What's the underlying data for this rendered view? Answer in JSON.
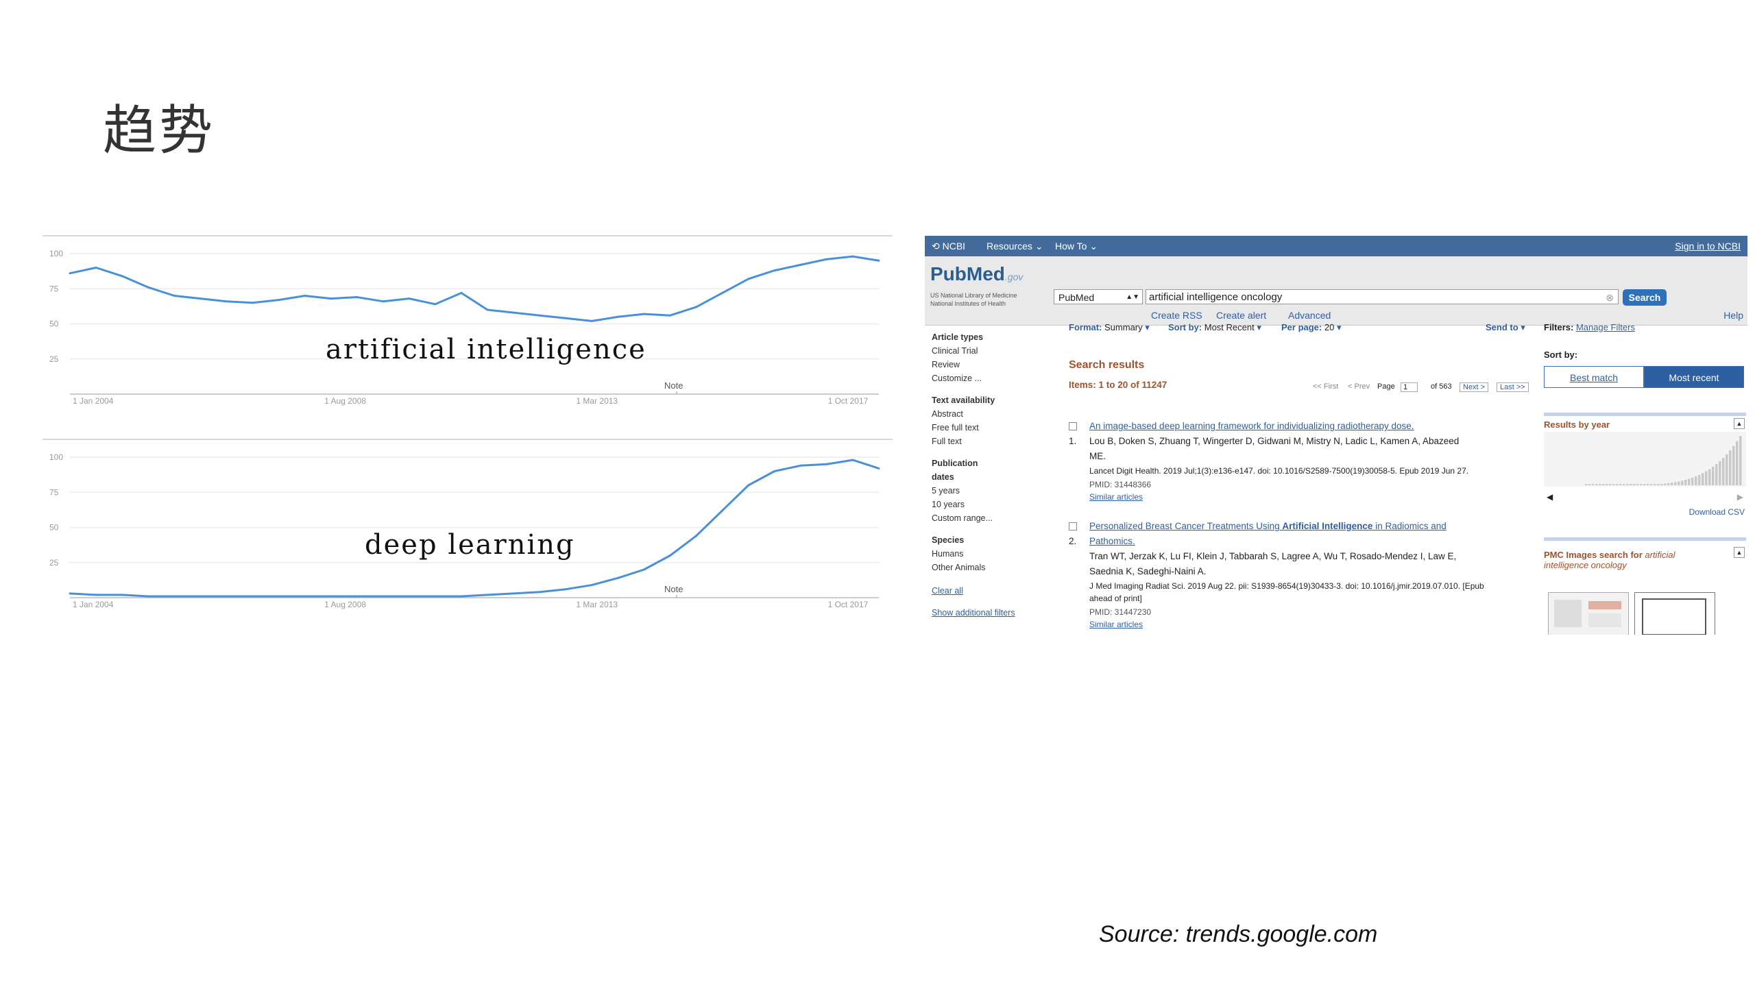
{
  "slide": {
    "title": "趋势",
    "source": "Source: trends.google.com"
  },
  "trends": {
    "ai": {
      "overlay_label": "artificial intelligence",
      "y_ticks": [
        "100",
        "75",
        "50",
        "25"
      ],
      "x_ticks": [
        "1 Jan 2004",
        "1 Aug 2008",
        "1 Mar 2013",
        "1 Oct 2017"
      ],
      "note": "Note",
      "line_color": "#4a90d9"
    },
    "dl": {
      "overlay_label": "deep learning",
      "y_ticks": [
        "100",
        "75",
        "50",
        "25"
      ],
      "x_ticks": [
        "1 Jan 2004",
        "1 Aug 2008",
        "1 Mar 2013",
        "1 Oct 2017"
      ],
      "note": "Note",
      "line_color": "#4a90d9"
    }
  },
  "chart_data": [
    {
      "type": "line",
      "x_ticks": [
        "1 Jan 2004",
        "1 Aug 2008",
        "1 Mar 2013",
        "1 Oct 2017"
      ],
      "ylim": [
        0,
        100
      ],
      "x": [
        2004.0,
        2004.5,
        2005.0,
        2005.5,
        2006.0,
        2006.5,
        2007.0,
        2007.5,
        2008.0,
        2008.5,
        2009.0,
        2009.5,
        2010.0,
        2010.5,
        2011.0,
        2011.5,
        2012.0,
        2012.5,
        2013.0,
        2013.5,
        2014.0,
        2014.5,
        2015.0,
        2015.5,
        2016.0,
        2016.5,
        2017.0,
        2017.5,
        2018.0,
        2018.5,
        2019.0,
        2019.5
      ],
      "values": [
        86,
        90,
        84,
        76,
        70,
        68,
        66,
        65,
        67,
        70,
        68,
        69,
        66,
        68,
        64,
        72,
        60,
        58,
        56,
        54,
        52,
        55,
        57,
        56,
        62,
        72,
        82,
        88,
        92,
        96,
        98,
        95
      ]
    },
    {
      "type": "line",
      "x_ticks": [
        "1 Jan 2004",
        "1 Aug 2008",
        "1 Mar 2013",
        "1 Oct 2017"
      ],
      "ylim": [
        0,
        100
      ],
      "x": [
        2004.0,
        2004.5,
        2005.0,
        2005.5,
        2006.0,
        2006.5,
        2007.0,
        2007.5,
        2008.0,
        2008.5,
        2009.0,
        2009.5,
        2010.0,
        2010.5,
        2011.0,
        2011.5,
        2012.0,
        2012.5,
        2013.0,
        2013.5,
        2014.0,
        2014.5,
        2015.0,
        2015.5,
        2016.0,
        2016.5,
        2017.0,
        2017.5,
        2018.0,
        2018.5,
        2019.0,
        2019.5
      ],
      "values": [
        3,
        2,
        2,
        1,
        1,
        1,
        1,
        1,
        1,
        1,
        1,
        1,
        1,
        1,
        1,
        1,
        2,
        3,
        4,
        6,
        9,
        14,
        20,
        30,
        44,
        62,
        80,
        90,
        94,
        95,
        98,
        92
      ]
    }
  ],
  "pubmed": {
    "top_bar": {
      "ncbi": "NCBI",
      "resources": "Resources",
      "how_to": "How To",
      "sign_in": "Sign in to NCBI"
    },
    "logo": {
      "text": "PubMed",
      "gov": ".gov",
      "sub1": "US National Library of Medicine",
      "sub2": "National Institutes of Health"
    },
    "search": {
      "db": "PubMed",
      "query": "artificial intelligence oncology",
      "button": "Search",
      "create_rss": "Create RSS",
      "create_alert": "Create alert",
      "advanced": "Advanced",
      "help": "Help"
    },
    "filters": {
      "article_types_h": "Article types",
      "clinical_trial": "Clinical Trial",
      "review": "Review",
      "customize": "Customize ...",
      "text_availability_h": "Text availability",
      "abstract": "Abstract",
      "free_full_text": "Free full text",
      "full_text": "Full text",
      "pub_dates_h1": "Publication",
      "pub_dates_h2": "dates",
      "five_years": "5 years",
      "ten_years": "10 years",
      "custom_range": "Custom range...",
      "species_h": "Species",
      "humans": "Humans",
      "other_animals": "Other Animals",
      "clear_all": "Clear all",
      "show_additional": "Show additional filters"
    },
    "toolbar": {
      "format_label": "Format:",
      "format_value": "Summary",
      "sort_label": "Sort by:",
      "sort_value": "Most Recent",
      "perpage_label": "Per page:",
      "perpage_value": "20",
      "send_to": "Send to"
    },
    "results": {
      "heading": "Search results",
      "items": "Items: 1 to 20 of 11247",
      "first": "<< First",
      "prev": "< Prev",
      "page_label": "Page",
      "page_value": "1",
      "of_pages": "of 563",
      "next": "Next >",
      "last": "Last >>",
      "list": [
        {
          "num": "1.",
          "title": "An image-based deep learning framework for individualizing radiotherapy dose.",
          "authors1": "Lou B, Doken S, Zhuang T, Wingerter D, Gidwani M, Mistry N, Ladic L, Kamen A, Abazeed",
          "authors2": "ME.",
          "journal": "Lancet Digit Health. 2019 Jul;1(3):e136-e147. doi: 10.1016/S2589-7500(19)30058-5. Epub 2019 Jun 27.",
          "pmid": "PMID: 31448366",
          "similar": "Similar articles"
        },
        {
          "num": "2.",
          "title_a": "Personalized Breast Cancer Treatments Using ",
          "title_b": "Artificial Intelligence",
          "title_c": " in Radiomics and",
          "title_d": "Pathomics.",
          "authors1": "Tran WT, Jerzak K, Lu FI, Klein J, Tabbarah S, Lagree A, Wu T, Rosado-Mendez I, Law E,",
          "authors2": "Saednia K, Sadeghi-Naini A.",
          "journal1": "J Med Imaging Radiat Sci. 2019 Aug 22. pii: S1939-8654(19)30433-3. doi: 10.1016/j.jmir.2019.07.010. [Epub",
          "journal2": "ahead of print]",
          "pmid": "PMID: 31447230",
          "similar": "Similar articles"
        }
      ]
    },
    "right": {
      "filters_label": "Filters:",
      "manage_filters": "Manage Filters",
      "sort_by": "Sort by:",
      "best_match": "Best match",
      "most_recent": "Most recent",
      "results_by_year": "Results by year",
      "download_csv": "Download CSV",
      "pmc_a": "PMC Images search for ",
      "pmc_b": "artificial",
      "pmc_c": "intelligence oncology"
    }
  }
}
